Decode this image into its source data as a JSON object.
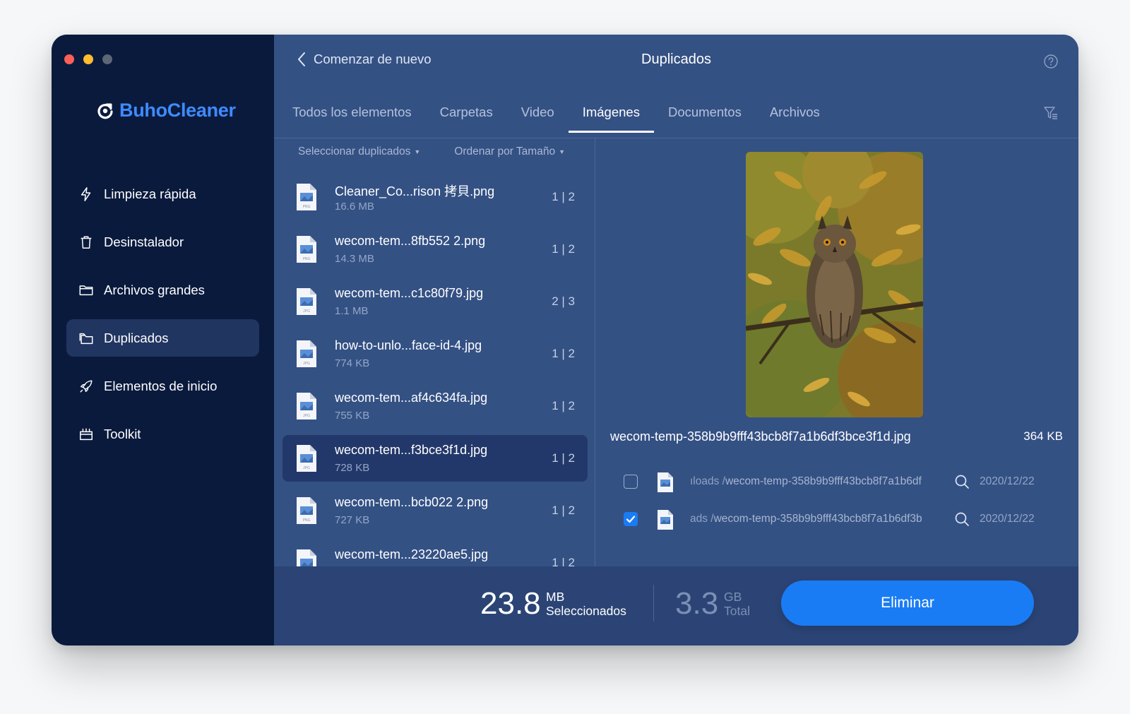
{
  "app": {
    "name": "BuhoCleaner"
  },
  "colors": {
    "sidebar_bg": "#0a1a3d",
    "main_bg": "#345184",
    "accent": "#1a7cf5",
    "brand": "#3f8bff"
  },
  "sidebar": {
    "items": [
      {
        "label": "Limpieza rápida",
        "icon": "bolt-icon"
      },
      {
        "label": "Desinstalador",
        "icon": "trash-icon"
      },
      {
        "label": "Archivos grandes",
        "icon": "folder-icon"
      },
      {
        "label": "Duplicados",
        "icon": "duplicate-folder-icon",
        "active": true
      },
      {
        "label": "Elementos de inicio",
        "icon": "rocket-icon"
      },
      {
        "label": "Toolkit",
        "icon": "toolkit-icon"
      }
    ]
  },
  "header": {
    "back_label": "Comenzar de nuevo",
    "title": "Duplicados"
  },
  "tabs": [
    {
      "label": "Todos los elementos"
    },
    {
      "label": "Carpetas"
    },
    {
      "label": "Video"
    },
    {
      "label": "Imágenes",
      "active": true
    },
    {
      "label": "Documentos"
    },
    {
      "label": "Archivos"
    }
  ],
  "list_controls": {
    "select_label": "Seleccionar duplicados",
    "sort_label": "Ordenar por Tamaño"
  },
  "files": [
    {
      "name": "Cleaner_Co...rison 拷貝.png",
      "size": "16.6 MB",
      "count": "1 | 2",
      "type": "PNG"
    },
    {
      "name": "wecom-tem...8fb552 2.png",
      "size": "14.3 MB",
      "count": "1 | 2",
      "type": "PNG"
    },
    {
      "name": "wecom-tem...c1c80f79.jpg",
      "size": "1.1 MB",
      "count": "2 | 3",
      "type": "JPG"
    },
    {
      "name": "how-to-unlo...face-id-4.jpg",
      "size": "774 KB",
      "count": "1 | 2",
      "type": "JPG"
    },
    {
      "name": "wecom-tem...af4c634fa.jpg",
      "size": "755 KB",
      "count": "1 | 2",
      "type": "JPG"
    },
    {
      "name": "wecom-tem...f3bce3f1d.jpg",
      "size": "728 KB",
      "count": "1 | 2",
      "type": "JPG",
      "selected": true
    },
    {
      "name": "wecom-tem...bcb022 2.png",
      "size": "727 KB",
      "count": "1 | 2",
      "type": "PNG"
    },
    {
      "name": "wecom-tem...23220ae5.jpg",
      "size": "",
      "count": "1 | 2",
      "type": "JPG"
    }
  ],
  "preview": {
    "filename": "wecom-temp-358b9b9fff43bcb8f7a1b6df3bce3f1d.jpg",
    "size": "364 KB",
    "copies": [
      {
        "dir": "ıloads /",
        "file": "wecom-temp-358b9b9fff43bcb8f7a1b6df",
        "date": "2020/12/22",
        "checked": false
      },
      {
        "dir": "ads /",
        "file": "wecom-temp-358b9b9fff43bcb8f7a1b6df3b",
        "date": "2020/12/22",
        "checked": true
      }
    ]
  },
  "summary": {
    "selected_value": "23.8",
    "selected_unit": "MB",
    "selected_label": "Seleccionados",
    "total_value": "3.3",
    "total_unit": "GB",
    "total_label": "Total",
    "delete_label": "Eliminar"
  }
}
